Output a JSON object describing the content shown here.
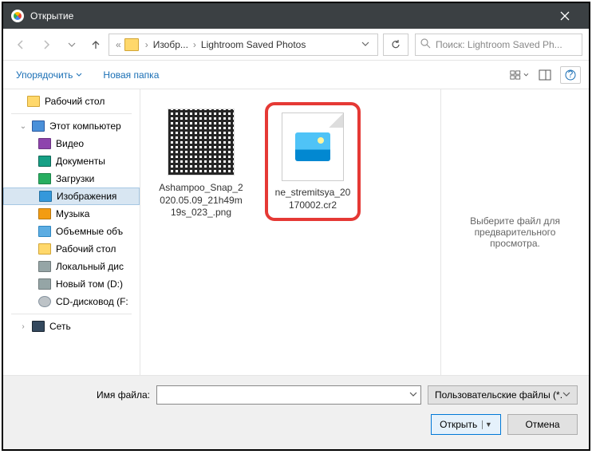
{
  "titlebar": {
    "title": "Открытие"
  },
  "addr": {
    "seg1": "Изобр...",
    "seg2": "Lightroom Saved Photos",
    "search_placeholder": "Поиск: Lightroom Saved Ph..."
  },
  "toolbar": {
    "organize": "Упорядочить",
    "newfolder": "Новая папка"
  },
  "sidebar": {
    "desktop": "Рабочий стол",
    "thispc": "Этот компьютер",
    "video": "Видео",
    "documents": "Документы",
    "downloads": "Загрузки",
    "pictures": "Изображения",
    "music": "Музыка",
    "objects": "Объемные объ",
    "desktop2": "Рабочий стол",
    "localdisk": "Локальный дис",
    "newvol": "Новый том (D:)",
    "cddrive": "CD-дисковод (F:",
    "network": "Сеть"
  },
  "files": [
    {
      "name": "Ashampoo_Snap_2020.05.09_21h49m19s_023_.png"
    },
    {
      "name": "ne_stremitsya_20170002.cr2"
    }
  ],
  "preview": {
    "text": "Выберите файл для предварительного просмотра."
  },
  "footer": {
    "filename_label": "Имя файла:",
    "filetype": "Пользовательские файлы (*.g",
    "open": "Открыть",
    "cancel": "Отмена"
  }
}
